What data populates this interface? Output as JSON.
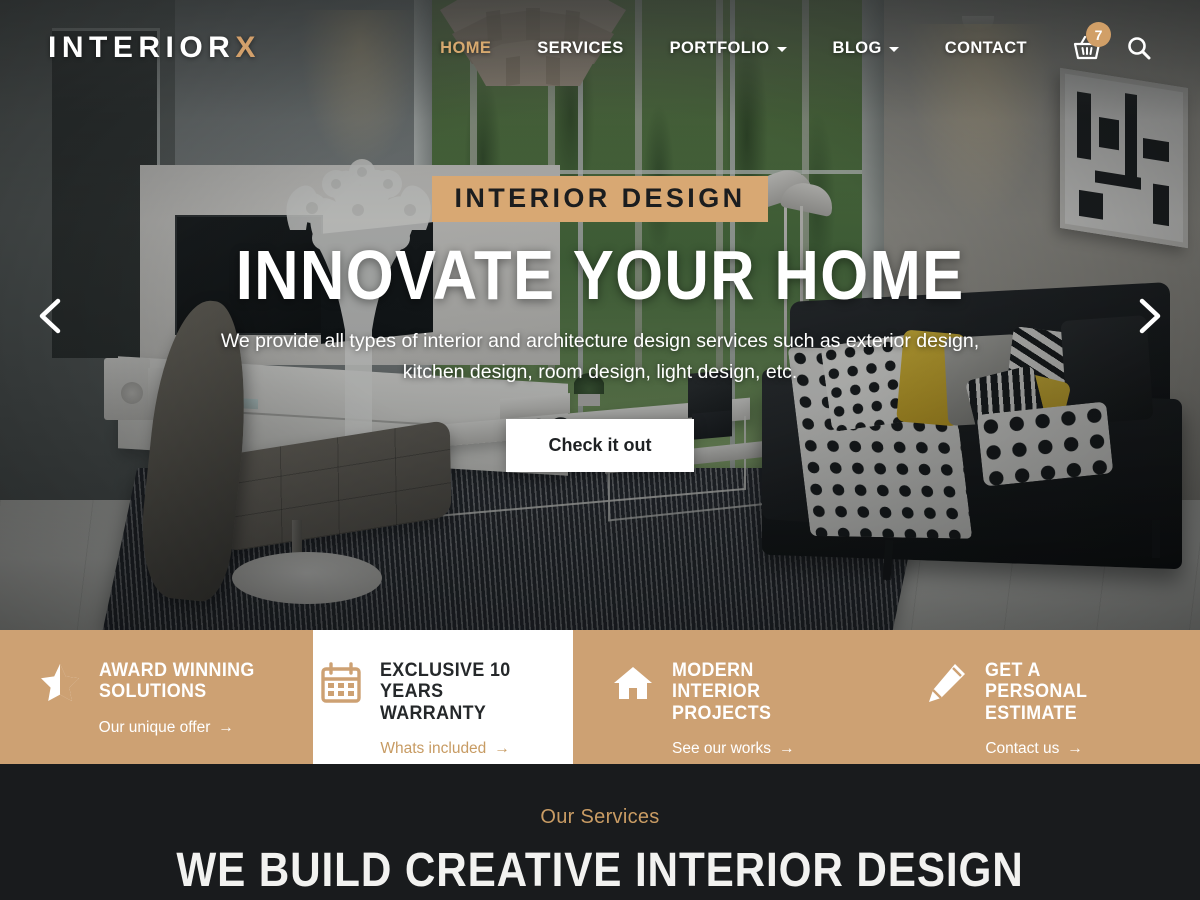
{
  "header": {
    "logo_main": "INTERIOR",
    "logo_accent": "X",
    "nav": [
      {
        "label": "HOME",
        "active": true,
        "dropdown": false
      },
      {
        "label": "SERVICES",
        "active": false,
        "dropdown": false
      },
      {
        "label": "PORTFOLIO",
        "active": false,
        "dropdown": true
      },
      {
        "label": "BLOG",
        "active": false,
        "dropdown": true
      },
      {
        "label": "CONTACT",
        "active": false,
        "dropdown": false
      }
    ],
    "cart_icon": "shopping-basket-icon",
    "cart_count": "7",
    "search_icon": "search-icon"
  },
  "hero": {
    "eyebrow": "INTERIOR DESIGN",
    "headline": "INNOVATE YOUR HOME",
    "subtitle": "We provide all types of interior and architecture design services such as exterior design, kitchen design, room design, light design, etc.",
    "cta_label": "Check it out",
    "prev_icon": "chevron-left-icon",
    "next_icon": "chevron-right-icon"
  },
  "features": [
    {
      "icon": "star-icon",
      "title": "AWARD WINNING SOLUTIONS",
      "link": "Our unique offer",
      "arrow": "→",
      "highlight": false
    },
    {
      "icon": "calendar-icon",
      "title": "EXCLUSIVE 10 YEARS WARRANTY",
      "link": "Whats included",
      "arrow": "→",
      "highlight": true
    },
    {
      "icon": "house-icon",
      "title": "MODERN INTERIOR PROJECTS",
      "link": "See our works",
      "arrow": "→",
      "highlight": false
    },
    {
      "icon": "pencil-icon",
      "title": "GET A PERSONAL ESTIMATE",
      "link": "Contact us",
      "arrow": "→",
      "highlight": false
    }
  ],
  "services": {
    "eyebrow": "Our Services",
    "title": "WE BUILD CREATIVE INTERIOR DESIGN"
  },
  "colors": {
    "accent_tan": "#CDA173",
    "accent_gold_text": "#D7A96F",
    "dark_section": "#191B1D",
    "eyebrow_badge": "#D8A873",
    "white": "#FFFFFF"
  }
}
